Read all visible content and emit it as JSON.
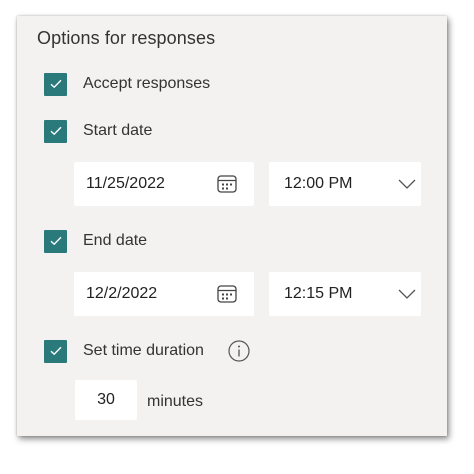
{
  "section": {
    "title": "Options for responses"
  },
  "accept_responses": {
    "label": "Accept responses",
    "checked": true
  },
  "start": {
    "label": "Start date",
    "checked": true,
    "date": "11/25/2022",
    "time": "12:00 PM"
  },
  "end": {
    "label": "End date",
    "checked": true,
    "date": "12/2/2022",
    "time": "12:15 PM"
  },
  "duration": {
    "label": "Set time duration",
    "checked": true,
    "value": "30",
    "unit": "minutes"
  },
  "icons": {
    "checkbox": "checkmark-icon",
    "date_picker": "calendar-icon",
    "time_dropdown": "chevron-down-icon",
    "info": "info-icon"
  },
  "colors": {
    "accent": "#2a7a7b",
    "panel_bg": "#f3f2f1",
    "field_bg": "#ffffff",
    "text": "#333333"
  }
}
